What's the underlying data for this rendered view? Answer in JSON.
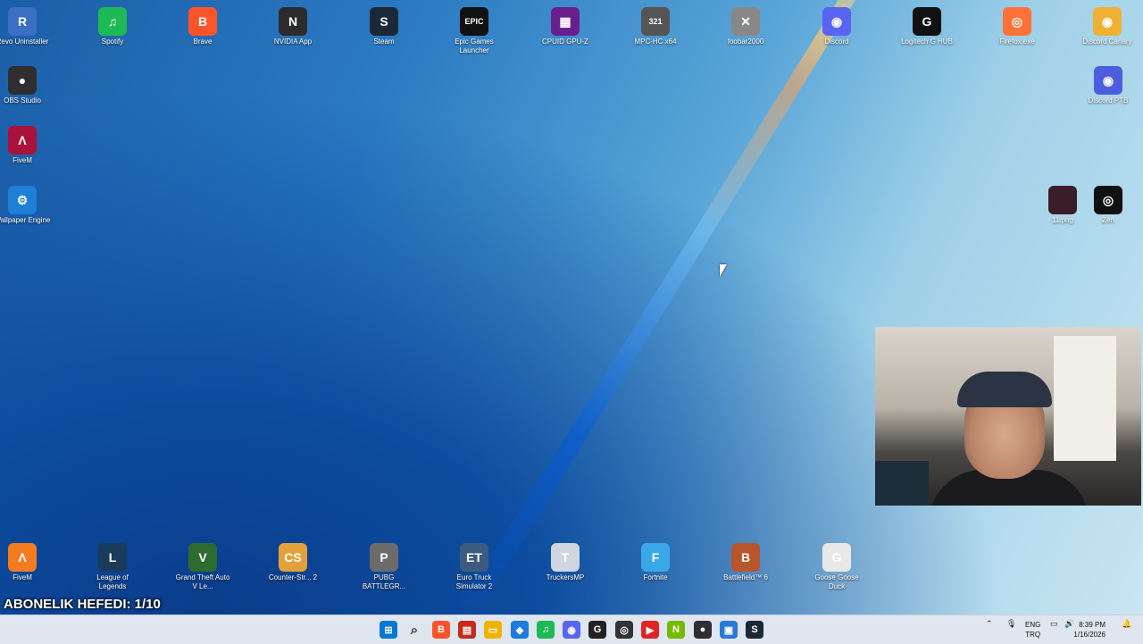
{
  "desktop_icons_top": [
    {
      "name": "revo-uninstaller",
      "label": "Revo Uninstaller",
      "glyph": "R",
      "color": "#3a6fc4"
    },
    {
      "name": "spotify",
      "label": "Spotify",
      "glyph": "♫",
      "color": "#1db954"
    },
    {
      "name": "brave",
      "label": "Brave",
      "glyph": "B",
      "color": "#fb542b"
    },
    {
      "name": "nvidia-app",
      "label": "NVIDIA App",
      "glyph": "N",
      "color": "#2c2c2c"
    },
    {
      "name": "steam",
      "label": "Steam",
      "glyph": "S",
      "color": "#1b2838"
    },
    {
      "name": "epic-games-launcher",
      "label": "Epic Games Launcher",
      "glyph": "EPIC",
      "color": "#111111"
    },
    {
      "name": "cpuid-gpu-z",
      "label": "CPUID GPU-Z",
      "glyph": "▦",
      "color": "#6a1f8f"
    },
    {
      "name": "mpc-hc",
      "label": "MPC-HC x64",
      "glyph": "321",
      "color": "#555555"
    },
    {
      "name": "foobar2000",
      "label": "foobar2000",
      "glyph": "✕",
      "color": "#888888"
    },
    {
      "name": "discord",
      "label": "Discord",
      "glyph": "◉",
      "color": "#5865f2"
    },
    {
      "name": "logitech-g-hub",
      "label": "Logitech G HUB",
      "glyph": "G",
      "color": "#111111"
    },
    {
      "name": "firefox",
      "label": "Firefox.exe",
      "glyph": "◎",
      "color": "#ff7139"
    },
    {
      "name": "discord-canary",
      "label": "Discord Canary",
      "glyph": "◉",
      "color": "#f0b132"
    }
  ],
  "desktop_icons_left": [
    {
      "name": "obs-studio",
      "label": "OBS Studio",
      "glyph": "●",
      "color": "#302e31"
    },
    {
      "name": "fivem",
      "label": "FiveM",
      "glyph": "Λ",
      "color": "#a8123b"
    },
    {
      "name": "wallpaper-engine",
      "label": "Wallpaper Engine",
      "glyph": "⚙",
      "color": "#1d7fd6"
    }
  ],
  "desktop_icons_right": [
    {
      "name": "discord-ptb",
      "label": "Discord PTB",
      "glyph": "◉",
      "color": "#4e5de0"
    },
    {
      "name": "file-11png",
      "label": "11.png",
      "glyph": "",
      "color": "#3a1d2a"
    },
    {
      "name": "zen",
      "label": "Zen",
      "glyph": "◎",
      "color": "#111111"
    }
  ],
  "desktop_icons_bottom": [
    {
      "name": "fivem-bottom",
      "label": "FiveM",
      "glyph": "Λ",
      "color": "#f47b20"
    },
    {
      "name": "league-of-legends",
      "label": "League of Legends",
      "glyph": "L",
      "color": "#1b3b5a"
    },
    {
      "name": "gta-v",
      "label": "Grand Theft Auto V Le...",
      "glyph": "V",
      "color": "#2e6b2e"
    },
    {
      "name": "counter-strike-2",
      "label": "Counter-Str... 2",
      "glyph": "CS",
      "color": "#e2a13a"
    },
    {
      "name": "pubg",
      "label": "PUBG BATTLEGR...",
      "glyph": "P",
      "color": "#6b6b6b"
    },
    {
      "name": "euro-truck-simulator-2",
      "label": "Euro Truck Simulator 2",
      "glyph": "ET",
      "color": "#3d5a80"
    },
    {
      "name": "truckersmp",
      "label": "TruckersMP",
      "glyph": "T",
      "color": "#cfd6e0"
    },
    {
      "name": "fortnite",
      "label": "Fortnite",
      "glyph": "F",
      "color": "#3aa7e8"
    },
    {
      "name": "battlefield-6",
      "label": "Battlefield™ 6",
      "glyph": "B",
      "color": "#b8552a"
    },
    {
      "name": "goose-goose-duck",
      "label": "Goose Goose Duck",
      "glyph": "G",
      "color": "#e8e8e8"
    }
  ],
  "overlay": {
    "subscriber_goal": "ABONELIK HEFEDI: 1/10"
  },
  "taskbar": {
    "icons": [
      {
        "name": "start-button",
        "glyph": "⊞",
        "color": "#0078d4"
      },
      {
        "name": "search-button",
        "glyph": "⌕",
        "color": "#4a4a4a"
      },
      {
        "name": "brave-taskbar",
        "glyph": "B",
        "color": "#fb542b"
      },
      {
        "name": "app-red-taskbar",
        "glyph": "▤",
        "color": "#c42b1c"
      },
      {
        "name": "file-explorer",
        "glyph": "▭",
        "color": "#f2b200"
      },
      {
        "name": "defender",
        "glyph": "◆",
        "color": "#1f7ae0"
      },
      {
        "name": "spotify-taskbar",
        "glyph": "♫",
        "color": "#1db954"
      },
      {
        "name": "discord-taskbar",
        "glyph": "◉",
        "color": "#5865f2"
      },
      {
        "name": "logitech-taskbar",
        "glyph": "G",
        "color": "#222222"
      },
      {
        "name": "zen-taskbar",
        "glyph": "◎",
        "color": "#333333"
      },
      {
        "name": "youtube-taskbar",
        "glyph": "▶",
        "color": "#e02424"
      },
      {
        "name": "nvidia-taskbar",
        "glyph": "N",
        "color": "#76b900"
      },
      {
        "name": "obs-taskbar",
        "glyph": "●",
        "color": "#302e31"
      },
      {
        "name": "app-blue-taskbar",
        "glyph": "▣",
        "color": "#2b79d6"
      },
      {
        "name": "steam-taskbar",
        "glyph": "S",
        "color": "#1b2838"
      }
    ],
    "language": {
      "line1": "ENG",
      "line2": "TRQ"
    },
    "time": "8:39 PM",
    "date": "1/16/2026"
  }
}
